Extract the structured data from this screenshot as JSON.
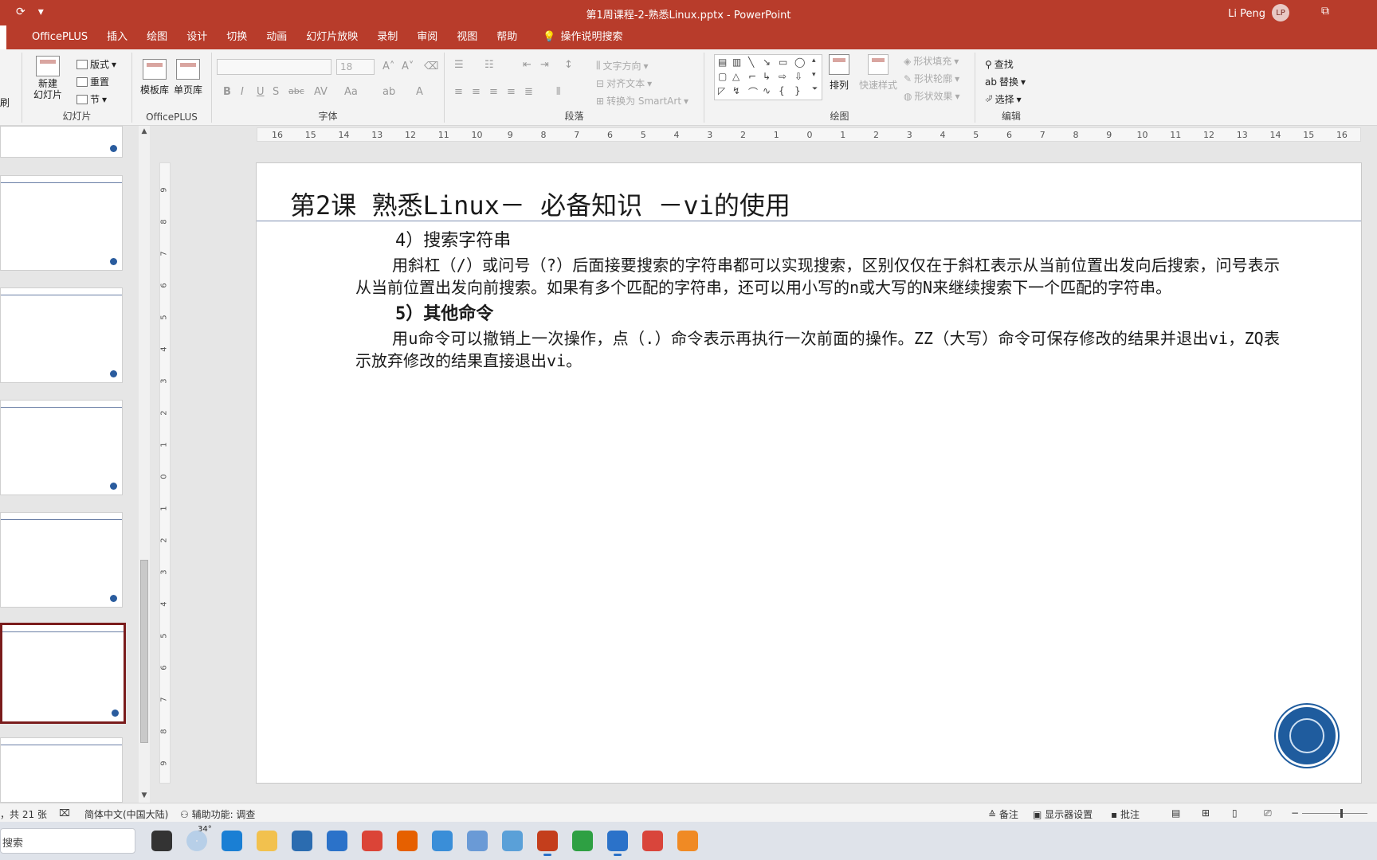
{
  "window": {
    "title": "第1周课程-2-熟悉Linux.pptx  -  PowerPoint",
    "user_name": "Li Peng",
    "user_initials": "LP",
    "qat_icons": [
      "autosave-icon",
      "customize-qat-icon"
    ]
  },
  "menu": {
    "tabs": [
      "OfficePLUS",
      "插入",
      "绘图",
      "设计",
      "切换",
      "动画",
      "幻灯片放映",
      "录制",
      "审阅",
      "视图",
      "帮助"
    ],
    "tell_me": "操作说明搜索"
  },
  "ribbon": {
    "slides_group": {
      "label": "幻灯片",
      "new_slide": "新建\n幻灯片",
      "layout": "版式",
      "reset": "重置",
      "section": "节",
      "clipboard_partial": "刷"
    },
    "officeplus_group": {
      "label": "OfficePLUS",
      "template_lib": "模板库",
      "single_page_lib": "单页库"
    },
    "font_group": {
      "label": "字体",
      "font_size": "18"
    },
    "paragraph_group": {
      "label": "段落",
      "text_direction": "文字方向",
      "align_text": "对齐文本",
      "convert_smartart": "转换为 SmartArt"
    },
    "drawing_group": {
      "label": "绘图",
      "arrange": "排列",
      "quick_styles": "快速样式",
      "shape_fill": "形状填充",
      "shape_outline": "形状轮廓",
      "shape_effects": "形状效果"
    },
    "editing_group": {
      "label": "编辑",
      "find": "查找",
      "replace": "替换",
      "select": "选择"
    }
  },
  "ruler": {
    "h_labels": [
      "16",
      "15",
      "14",
      "13",
      "12",
      "11",
      "10",
      "9",
      "8",
      "7",
      "6",
      "5",
      "4",
      "3",
      "2",
      "1",
      "0",
      "1",
      "2",
      "3",
      "4",
      "5",
      "6",
      "7",
      "8",
      "9",
      "10",
      "11",
      "12",
      "13",
      "14",
      "15",
      "16"
    ],
    "v_labels": [
      "9",
      "8",
      "7",
      "6",
      "5",
      "4",
      "3",
      "2",
      "1",
      "0",
      "1",
      "2",
      "3",
      "4",
      "5",
      "6",
      "7",
      "8",
      "9"
    ]
  },
  "slide": {
    "title": "第2课 熟悉Linux－ 必备知识 －vi的使用",
    "section4_heading": "4）搜索字符串",
    "section4_body": "用斜杠（/）或问号（?）后面接要搜索的字符串都可以实现搜索，区别仅仅在于斜杠表示从当前位置出发向后搜索，问号表示从当前位置出发向前搜索。如果有多个匹配的字符串，还可以用小写的n或大写的N来继续搜索下一个匹配的字符串。",
    "section5_heading": "5）其他命令",
    "section5_body": "用u命令可以撤销上一次操作，点（.）命令表示再执行一次前面的操作。ZZ（大写）命令可保存修改的结果并退出vi，ZQ表示放弃修改的结果直接退出vi。"
  },
  "statusbar": {
    "slide_count": "，共 21 张",
    "language": "简体中文(中国大陆)",
    "accessibility": "辅助功能: 调查",
    "notes": "备注",
    "display_settings": "显示器设置",
    "comments": "批注"
  },
  "taskbar": {
    "search_placeholder": "搜索",
    "temperature": "34°",
    "apps": [
      "task-view-icon",
      "weather-icon",
      "edge-icon",
      "file-explorer-icon",
      "store-icon",
      "mail-icon",
      "chrome-icon",
      "firefox-icon",
      "app-icon",
      "chart-app-icon",
      "monitor-app-icon",
      "powerpoint-icon",
      "wechat-icon",
      "feishu-icon",
      "app-red-icon",
      "app-orange-icon"
    ]
  },
  "colors": {
    "accent": "#b83c2b",
    "selected_thumb_border": "#7a1c1c",
    "seal": "#1f5c9e"
  }
}
